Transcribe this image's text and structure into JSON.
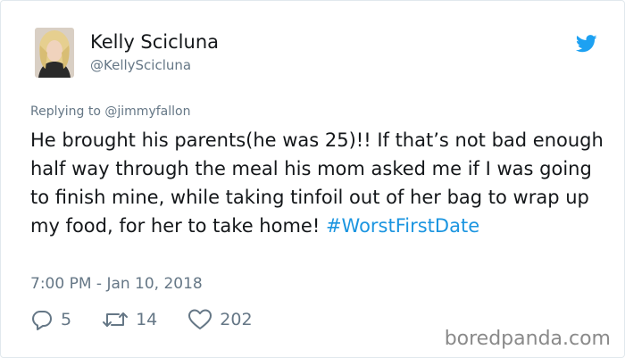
{
  "tweet": {
    "author": {
      "display_name": "Kelly Scicluna",
      "handle": "@KellyScicluna"
    },
    "replying_prefix": "Replying to",
    "replying_to": "@jimmyfallon",
    "text": "He brought his parents(he was 25)!! If that’s not bad enough half way through the meal his mom asked me if I was going to finish mine, while taking tinfoil out of her bag to wrap up my food, for her to take home!",
    "hashtag": "#WorstFirstDate",
    "timestamp": "7:00 PM - Jan 10, 2018",
    "stats": {
      "replies": "5",
      "retweets": "14",
      "likes": "202"
    },
    "icons": {
      "platform": "twitter-bird-icon",
      "reply": "reply-bubble-icon",
      "retweet": "retweet-icon",
      "like": "heart-icon"
    }
  },
  "watermark": "boredpanda.com",
  "colors": {
    "text": "#14171a",
    "secondary": "#657786",
    "link": "#1b95e0",
    "twitter_blue": "#1da1f2",
    "border": "#e1e8ed"
  }
}
